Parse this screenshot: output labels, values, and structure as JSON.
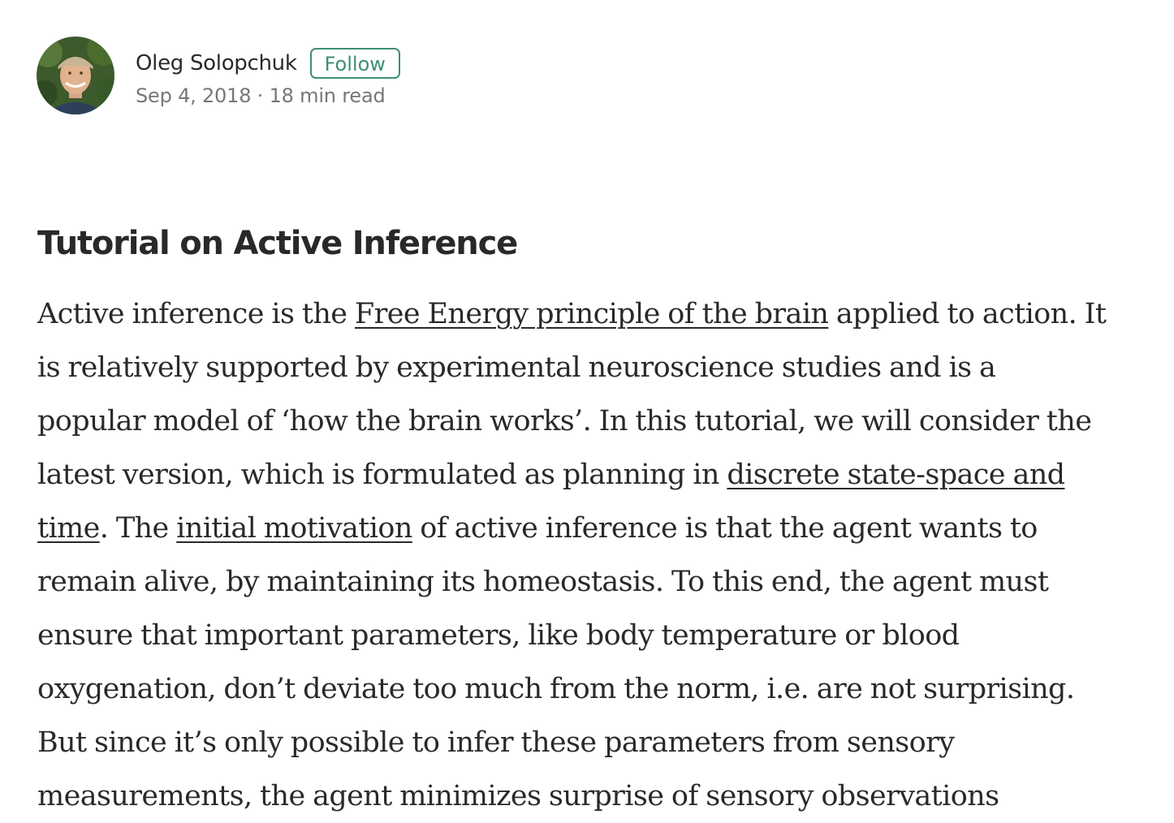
{
  "author": {
    "name": "Oleg Solopchuk",
    "follow_label": "Follow",
    "date": "Sep 4, 2018",
    "separator": " · ",
    "read_time": "18 min read"
  },
  "article": {
    "title": "Tutorial on Active Inference",
    "lines": [
      [
        "Active inference is the ",
        {
          "link": "Free Energy principle of the brain"
        },
        " applied to action. It"
      ],
      [
        "is relatively supported by experimental neuroscience studies and is a"
      ],
      [
        "popular model of ‘how the brain works’. In this tutorial, we will consider the"
      ],
      [
        "latest version, which is formulated as planning in ",
        {
          "link": "discrete state-space and"
        }
      ],
      [
        {
          "link": "time"
        },
        ". The ",
        {
          "link": "initial motivation"
        },
        " of active inference is that the agent wants to"
      ],
      [
        "remain alive, by maintaining its homeostasis. To this end, the agent must"
      ],
      [
        "ensure that important parameters, like body temperature or blood"
      ],
      [
        "oxygenation, don’t deviate too much from the norm, i.e. are not surprising."
      ],
      [
        "But since it’s only possible to infer these parameters from sensory"
      ],
      [
        "measurements, the agent minimizes surprise of sensory observations"
      ]
    ]
  },
  "colors": {
    "accent": "#3e8e76",
    "text": "#292929",
    "muted": "#757575"
  }
}
